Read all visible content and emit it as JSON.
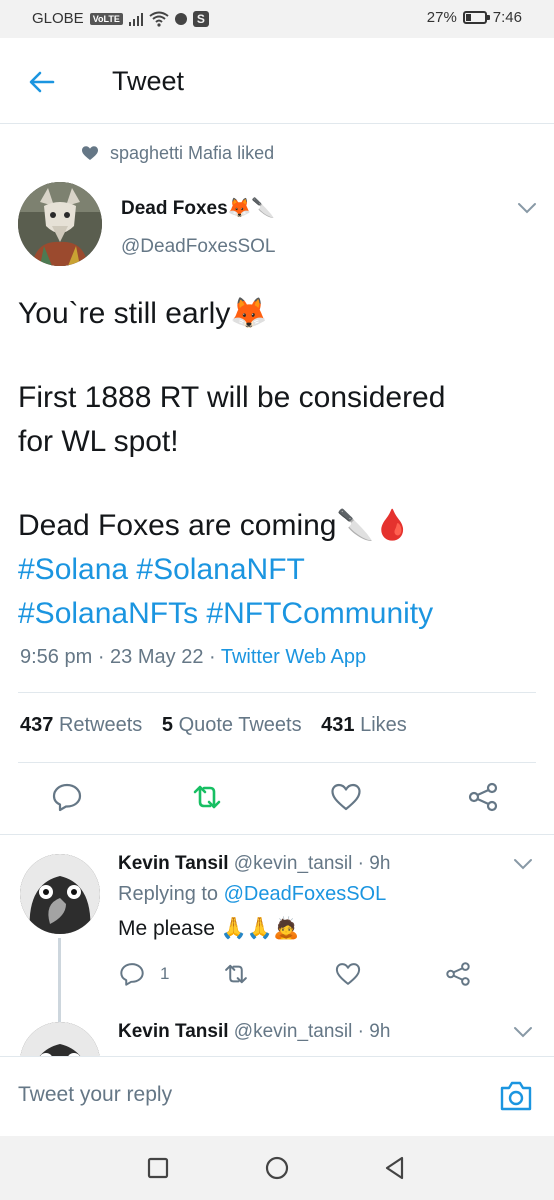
{
  "status_bar": {
    "carrier": "GLOBE",
    "volte": "VoLTE",
    "battery": "27%",
    "battery_level": 0.27,
    "time": "7:46"
  },
  "header": {
    "title": "Tweet",
    "back_icon": "arrow-left-icon"
  },
  "social_context": {
    "text": "spaghetti Mafia liked",
    "icon": "heart-icon"
  },
  "tweet": {
    "author_name": "Dead Foxes🦊🔪",
    "author_handle": "@DeadFoxesSOL",
    "lines": [
      "You`re still early🦊",
      "First 1888 RT will be considered",
      "for WL spot!",
      "Dead Foxes are coming🔪🩸"
    ],
    "hashtags_line1": "#Solana #SolanaNFT",
    "hashtags_line2": "#SolanaNFTs #NFTCommunity",
    "time": "9:56 pm",
    "date": "23 May 22",
    "app": "Twitter Web App",
    "retweets_count": "437",
    "retweets_label": "Retweets",
    "quotes_count": "5",
    "quotes_label": "Quote Tweets",
    "likes_count": "431",
    "likes_label": "Likes",
    "accent_color": "#1b95e0",
    "retweet_active_color": "#17bf63"
  },
  "replies": [
    {
      "name": "Kevin Tansil",
      "handle": "@kevin_tansil",
      "age": "9h",
      "replying_prefix": "Replying to",
      "replying_to": "@DeadFoxesSOL",
      "text": "Me please 🙏🙏🙇",
      "reply_count": "1"
    },
    {
      "name": "Kevin Tansil",
      "handle": "@kevin_tansil",
      "age": "9h"
    }
  ],
  "compose": {
    "placeholder": "Tweet your reply",
    "camera_icon": "camera-icon"
  },
  "navbar": {
    "icons": [
      "recents-square-icon",
      "home-circle-icon",
      "back-triangle-icon"
    ]
  }
}
